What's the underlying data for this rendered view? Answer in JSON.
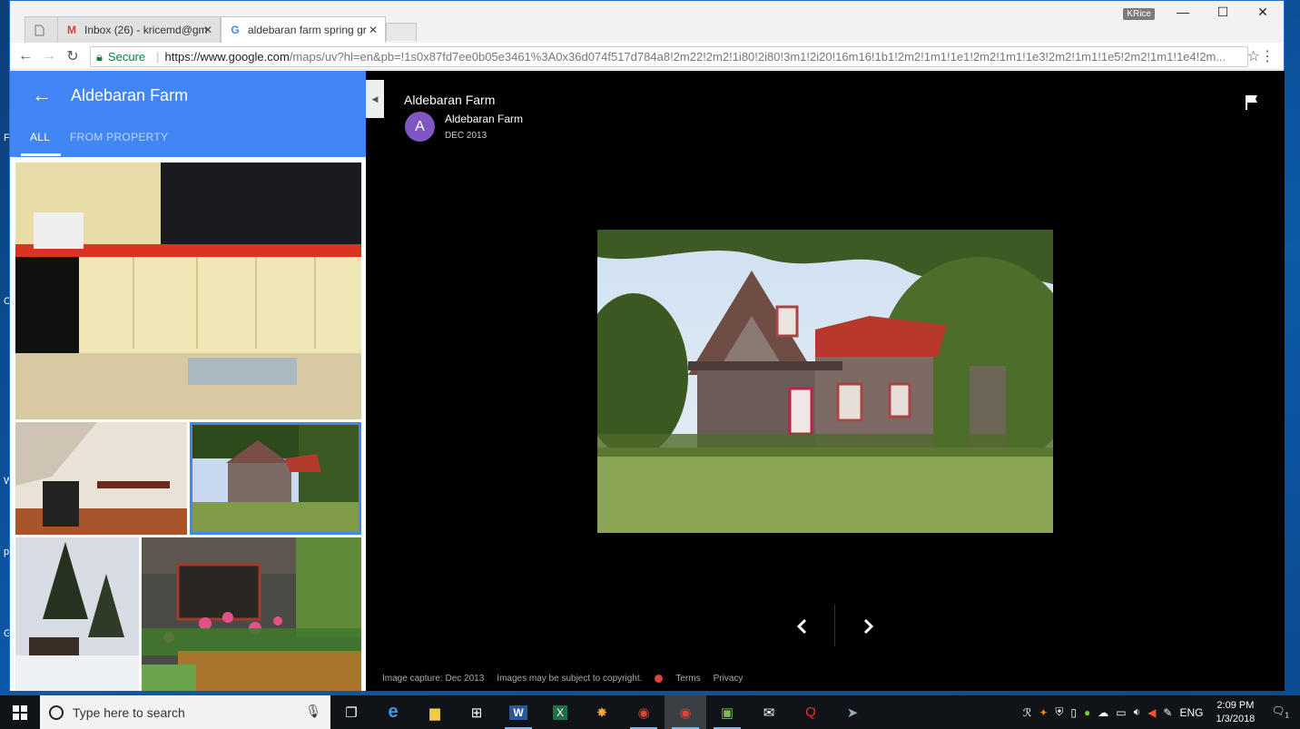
{
  "browser": {
    "tabs": [
      {
        "label": "",
        "type": "blank"
      },
      {
        "label": "Inbox (26) - kricemd@gm",
        "favicon": "gmail-icon",
        "color": "#d44638"
      },
      {
        "label": "aldebaran farm spring gr",
        "favicon": "google-icon",
        "color": "#4285f4"
      }
    ],
    "profile": "KRice",
    "secure_label": "Secure",
    "url_host": "https://www.google.com",
    "url_path": "/maps/uv?hl=en&pb=!1s0x87fd7ee0b05e3461%3A0x36d074f517d784a8!2m22!2m2!1i80!2i80!3m1!2i20!16m16!1b1!2m2!1m1!1e1!2m2!1m1!1e3!2m2!1m1!1e5!2m2!1m1!1e4!2m..."
  },
  "panel": {
    "title": "Aldebaran Farm",
    "tabs": [
      "ALL",
      "FROM PROPERTY"
    ]
  },
  "viewer": {
    "title": "Aldebaran Farm",
    "author": "Aldebaran Farm",
    "avatar_letter": "A",
    "date": "DEC 2013",
    "footer": {
      "capture": "Image capture: Dec 2013",
      "copyright": "Images may be subject to copyright.",
      "terms": "Terms",
      "privacy": "Privacy"
    }
  },
  "taskbar": {
    "search_placeholder": "Type here to search",
    "language": "ENG",
    "time": "2:09 PM",
    "date": "1/3/2018",
    "notifications": "1"
  },
  "desktop_letters": [
    "F",
    "C",
    "W",
    "p",
    "G"
  ],
  "colors": {
    "accent": "#4285f4",
    "viewer_bg": "#000000",
    "avatar": "#7e57c2"
  }
}
